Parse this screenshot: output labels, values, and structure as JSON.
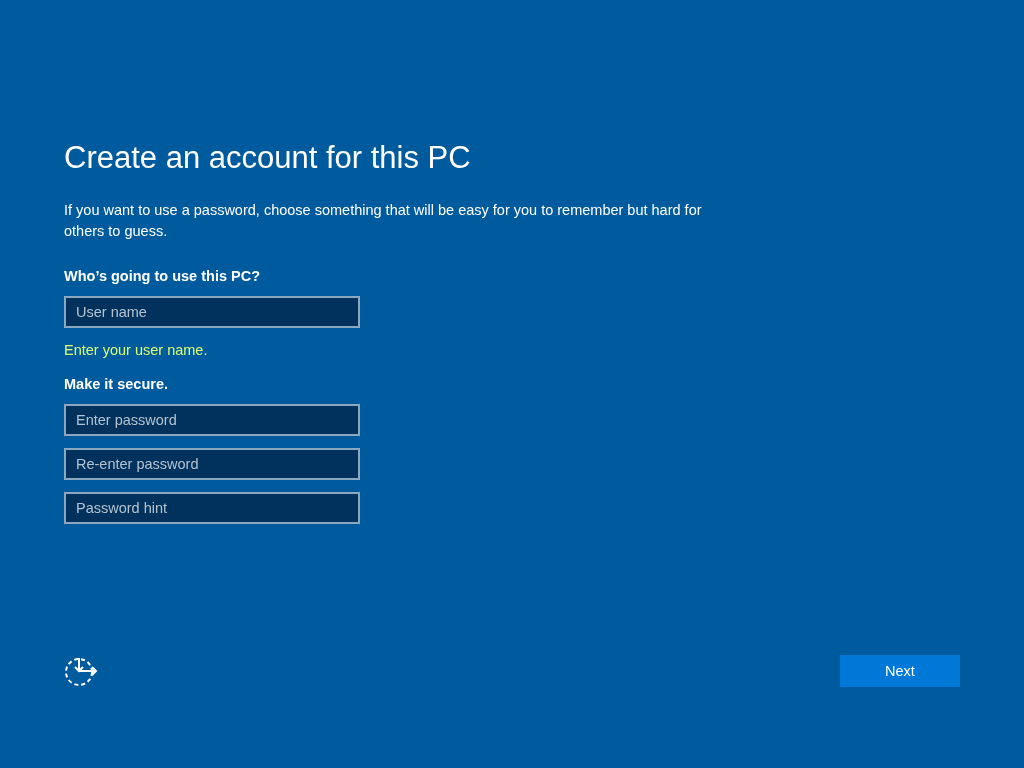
{
  "title": "Create an account for this PC",
  "description": "If you want to use a password, choose something that will be easy for you to remember but hard for others to guess.",
  "sections": [
    {
      "label": "Who’s going to use this PC?",
      "fields": [
        {
          "placeholder": "User name"
        }
      ],
      "error": "Enter your user name."
    },
    {
      "label": "Make it secure.",
      "fields": [
        {
          "placeholder": "Enter password"
        },
        {
          "placeholder": "Re-enter password"
        },
        {
          "placeholder": "Password hint"
        }
      ]
    }
  ],
  "buttons": [
    "Next"
  ]
}
